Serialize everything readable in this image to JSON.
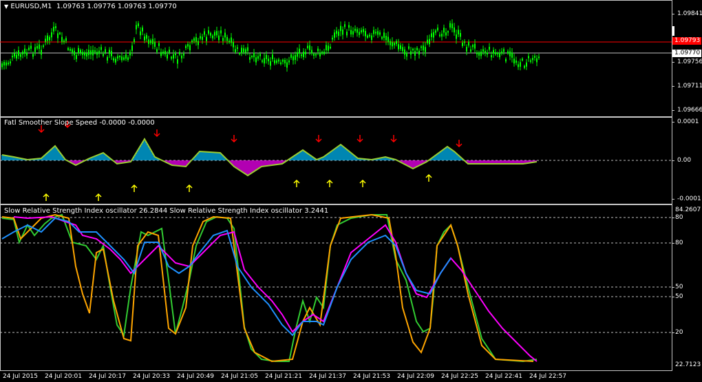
{
  "main_pane": {
    "title_symbol": "EURUSD,M1",
    "title_ohlc": "1.09763 1.09776 1.09763 1.09770",
    "dropdown_glyph": "▼",
    "price_labels": [
      "1.09841",
      "1.09796",
      "1.09770",
      "1.09756",
      "1.09711",
      "1.09666"
    ],
    "red_line_price": "1.09793",
    "current_price": "1.09770"
  },
  "fatl_pane": {
    "title": "Fatl Smoother Slope Speed -0.0000 -0.0000",
    "levels": [
      "0.0001",
      "0.00",
      "-0.0001"
    ]
  },
  "rsi_pane": {
    "title": "Slow Relative Strength Index oscillator 26.2844  Slow Relative Strength Index oscillator 3.2441",
    "levels": [
      "84.2607",
      "80",
      "80",
      "50",
      "50",
      "20",
      "22.7123"
    ]
  },
  "time_axis": [
    "24 Jul 2015",
    "24 Jul 20:01",
    "24 Jul 20:17",
    "24 Jul 20:33",
    "24 Jul 20:49",
    "24 Jul 21:05",
    "24 Jul 21:21",
    "24 Jul 21:37",
    "24 Jul 21:53",
    "24 Jul 22:09",
    "24 Jul 22:25",
    "24 Jul 22:41",
    "24 Jul 22:57"
  ],
  "colors": {
    "candles": "#00ff00",
    "red_line": "#ff0000",
    "hist_pos": "#00bfff",
    "hist_neg": "#ff00ff",
    "smoother": "#9acd32",
    "arrow_up": "#ffff00",
    "arrow_down": "#ff0000",
    "rsi_green": "#32cd32",
    "rsi_orange": "#ffa500",
    "rsi_magenta": "#ff00ff",
    "rsi_blue": "#1e90ff",
    "level_line": "#c0c0c0"
  }
}
